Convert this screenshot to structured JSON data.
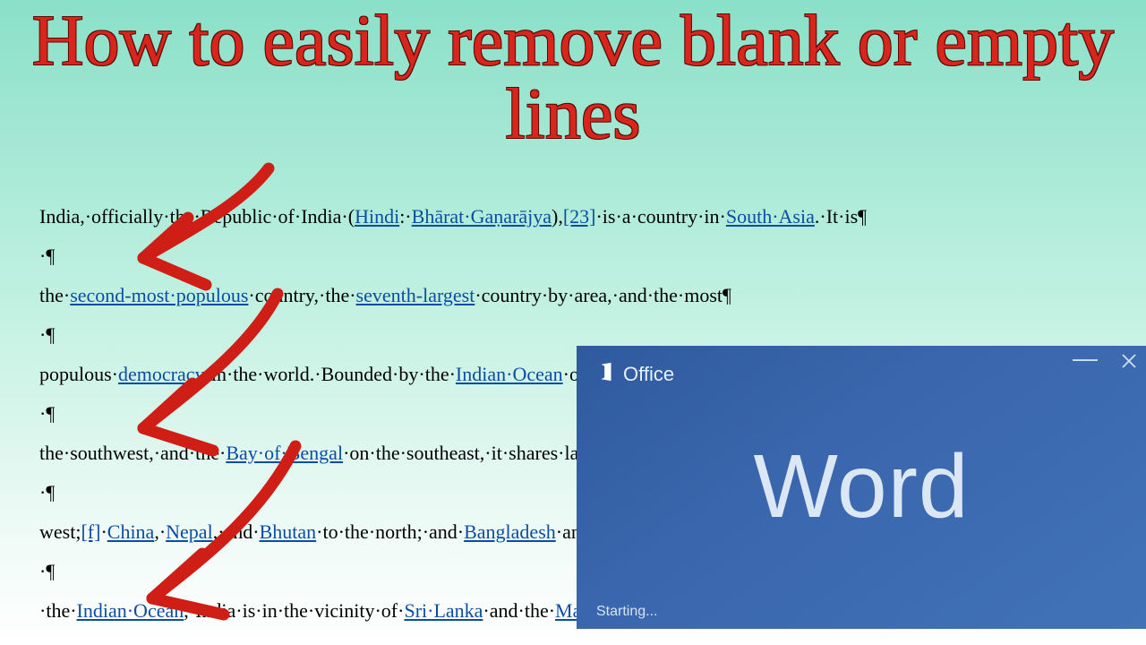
{
  "title": "How to easily remove blank or empty lines",
  "document": {
    "lines": [
      [
        {
          "t": "India,·officially·the·Republic·of·India·("
        },
        {
          "t": "Hindi",
          "link": true
        },
        {
          "t": ":·"
        },
        {
          "t": "Bhārat·Gaṇarājya",
          "link": true
        },
        {
          "t": "),"
        },
        {
          "t": "[23]",
          "link": true
        },
        {
          "t": "·is·a·country·in·"
        },
        {
          "t": "South·Asia",
          "link": true
        },
        {
          "t": ".·It·is¶"
        }
      ],
      [
        {
          "t": "·¶"
        }
      ],
      [
        {
          "t": "the·"
        },
        {
          "t": "second-most·populous",
          "link": true
        },
        {
          "t": "·country,·the·"
        },
        {
          "t": "seventh-largest",
          "link": true
        },
        {
          "t": "·country·by·area,·and·the·most¶"
        }
      ],
      [
        {
          "t": "·¶"
        }
      ],
      [
        {
          "t": "populous·"
        },
        {
          "t": "democracy",
          "link": true
        },
        {
          "t": "·in·the·world.·Bounded·by·the·"
        },
        {
          "t": "Indian·Ocean",
          "link": true
        },
        {
          "t": "·on·…"
        }
      ],
      [
        {
          "t": "·¶"
        }
      ],
      [
        {
          "t": "the·southwest,·and·the·"
        },
        {
          "t": "Bay·of·Bengal",
          "link": true
        },
        {
          "t": "·on·the·southeast,·it·shares·land"
        }
      ],
      [
        {
          "t": "·¶"
        }
      ],
      [
        {
          "t": "west;"
        },
        {
          "t": "[f]",
          "link": true
        },
        {
          "t": "·"
        },
        {
          "t": "China",
          "link": true
        },
        {
          "t": ",·"
        },
        {
          "t": "Nepal",
          "link": true
        },
        {
          "t": ",·and·"
        },
        {
          "t": "Bhutan",
          "link": true
        },
        {
          "t": "·to·the·north;·and·"
        },
        {
          "t": "Bangladesh",
          "link": true
        },
        {
          "t": "·and·"
        }
      ],
      [
        {
          "t": "·¶"
        }
      ],
      [
        {
          "t": "·the·"
        },
        {
          "t": "Indian·Ocean",
          "link": true
        },
        {
          "t": ",·India·is·in·the·vicinity·of·"
        },
        {
          "t": "Sri·Lanka",
          "link": true
        },
        {
          "t": "·and·the·"
        },
        {
          "t": "Maldi",
          "link": true
        }
      ]
    ]
  },
  "splash": {
    "brand": "Office",
    "app": "Word",
    "status": "Starting..."
  }
}
